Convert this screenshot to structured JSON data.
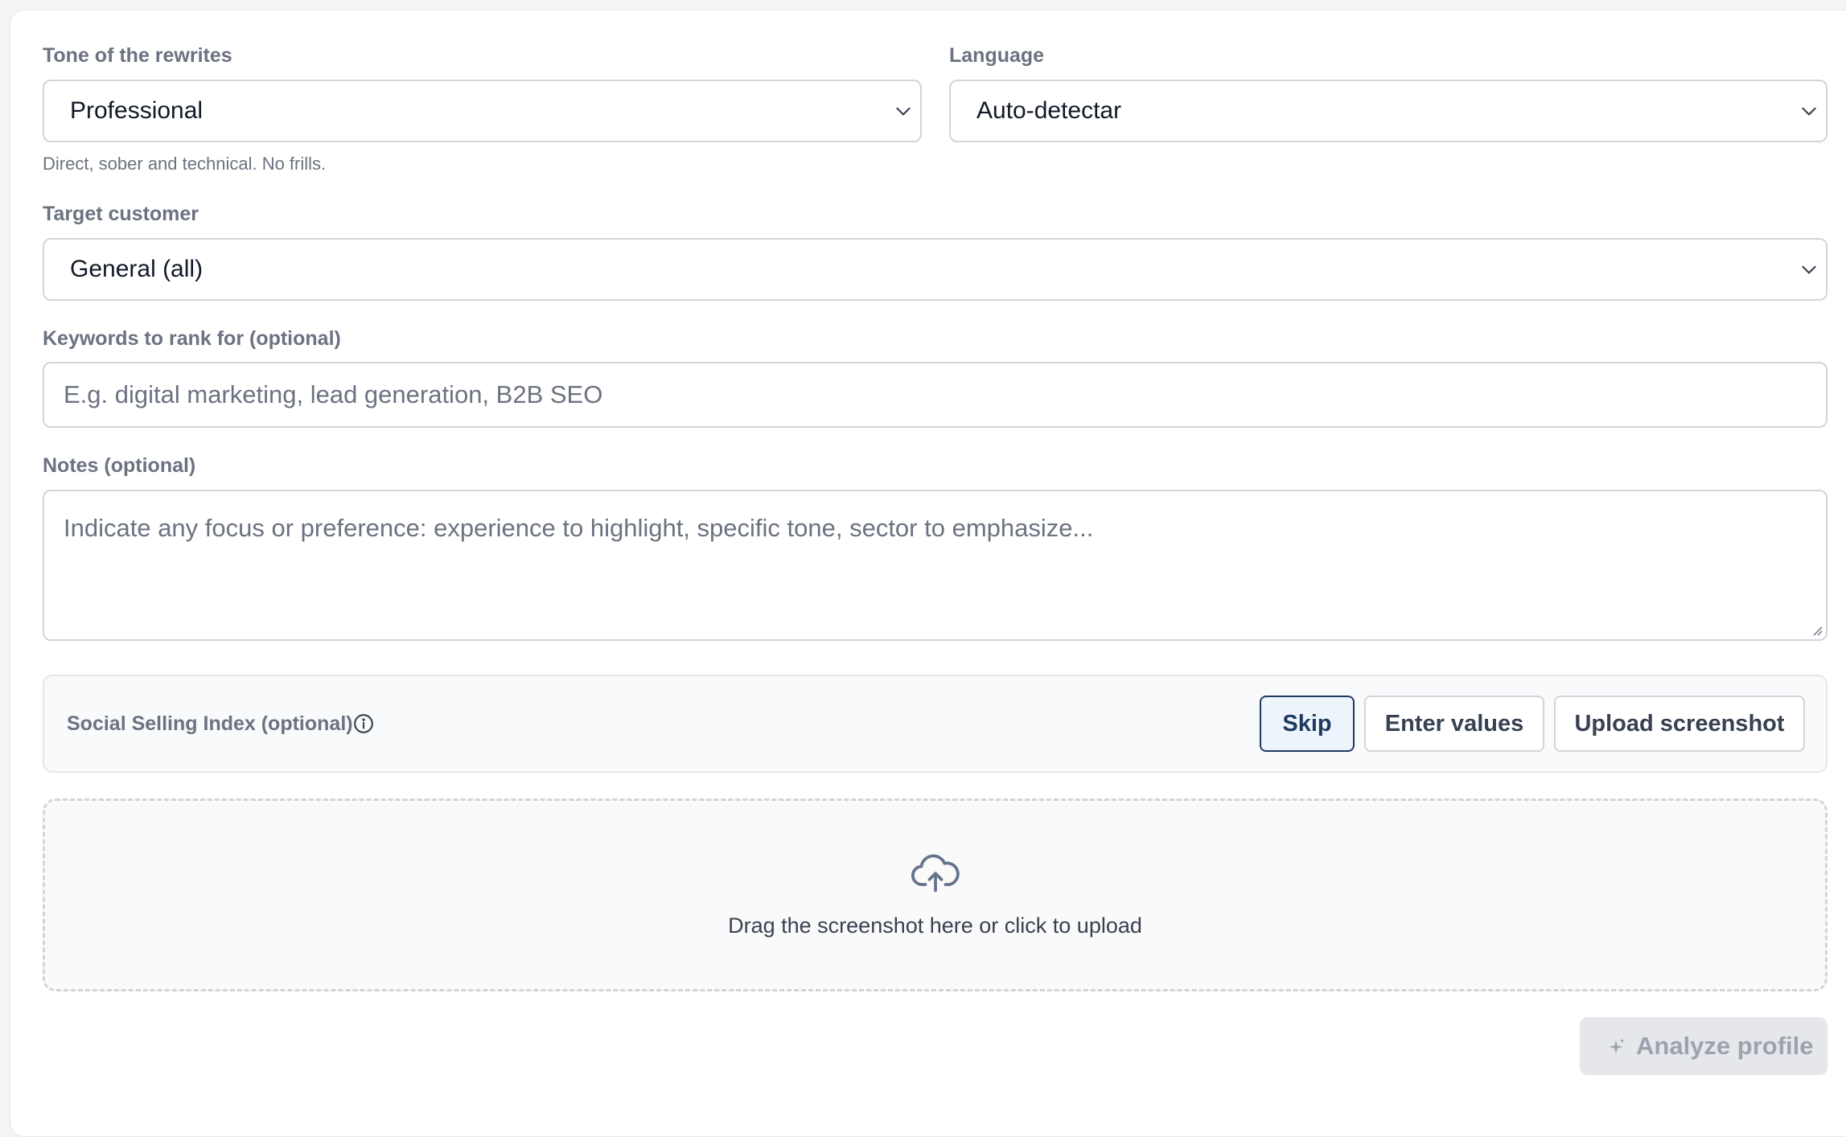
{
  "tone": {
    "label": "Tone of the rewrites",
    "selected": "Professional",
    "hint": "Direct, sober and technical. No frills."
  },
  "language": {
    "label": "Language",
    "selected": "Auto-detectar"
  },
  "target_customer": {
    "label": "Target customer",
    "selected": "General (all)"
  },
  "keywords": {
    "label": "Keywords to rank for (optional)",
    "placeholder": "E.g. digital marketing, lead generation, B2B SEO"
  },
  "notes": {
    "label": "Notes (optional)",
    "placeholder": "Indicate any focus or preference: experience to highlight, specific tone, sector to emphasize..."
  },
  "ssi": {
    "label": "Social Selling Index (optional)",
    "info_icon": "info-circle-icon",
    "options": {
      "skip": "Skip",
      "enter_values": "Enter values",
      "upload_screenshot": "Upload screenshot"
    },
    "selected_option": "Skip"
  },
  "dropzone": {
    "icon": "cloud-upload-icon",
    "text": "Drag the screenshot here or click to upload"
  },
  "analyze_button": {
    "icon": "sparkles-icon",
    "label": "Analyze profile",
    "disabled": true
  },
  "colors": {
    "accent": "#1e3a5f",
    "border": "#d1d5db",
    "muted_text": "#6b7280",
    "disabled_bg": "#e5e7eb"
  }
}
